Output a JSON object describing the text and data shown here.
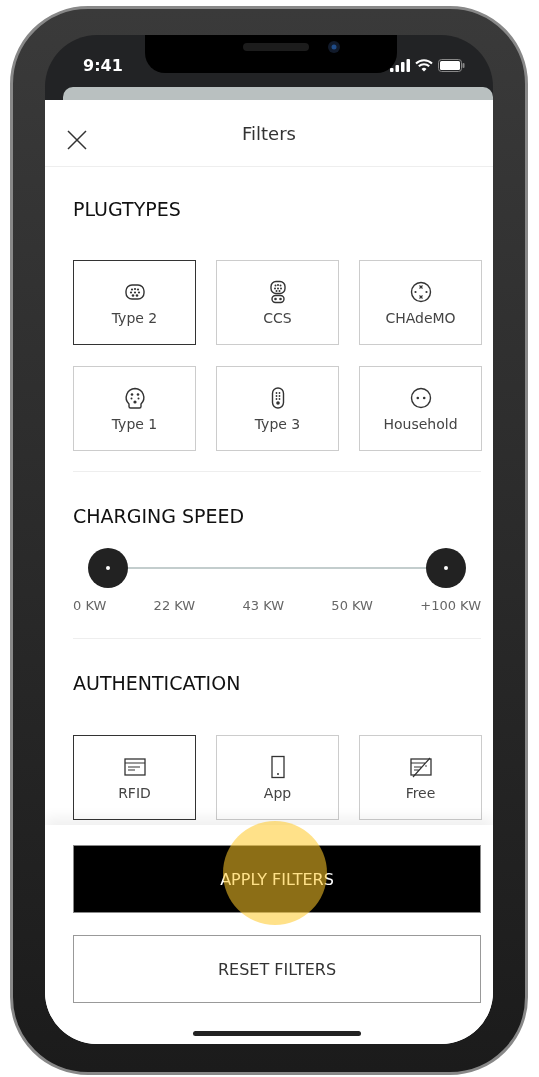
{
  "status_bar": {
    "time": "9:41"
  },
  "header": {
    "title": "Filters"
  },
  "plugtypes": {
    "heading": "PLUGTYPES",
    "options": [
      {
        "kind": "type2",
        "label": "Type 2",
        "selected": true
      },
      {
        "kind": "ccs",
        "label": "CCS",
        "selected": false
      },
      {
        "kind": "chademo",
        "label": "CHAdeMO",
        "selected": false
      },
      {
        "kind": "type1",
        "label": "Type 1",
        "selected": false
      },
      {
        "kind": "type3",
        "label": "Type 3",
        "selected": false
      },
      {
        "kind": "household",
        "label": "Household",
        "selected": false
      }
    ]
  },
  "charging_speed": {
    "heading": "CHARGING SPEED",
    "thumbs": [
      {
        "level": 0
      },
      {
        "level": 1
      }
    ],
    "labels": [
      "0 KW",
      "22 KW",
      "43 KW",
      "50 KW",
      "+100 KW"
    ]
  },
  "authentication": {
    "heading": "AUTHENTICATION",
    "options": [
      {
        "kind": "rfid",
        "label": "RFID",
        "selected": true
      },
      {
        "kind": "app",
        "label": "App",
        "selected": false
      },
      {
        "kind": "free",
        "label": "Free",
        "selected": false
      }
    ]
  },
  "buttons": {
    "apply": "APPLY FILTERS",
    "reset": "RESET FILTERS"
  }
}
